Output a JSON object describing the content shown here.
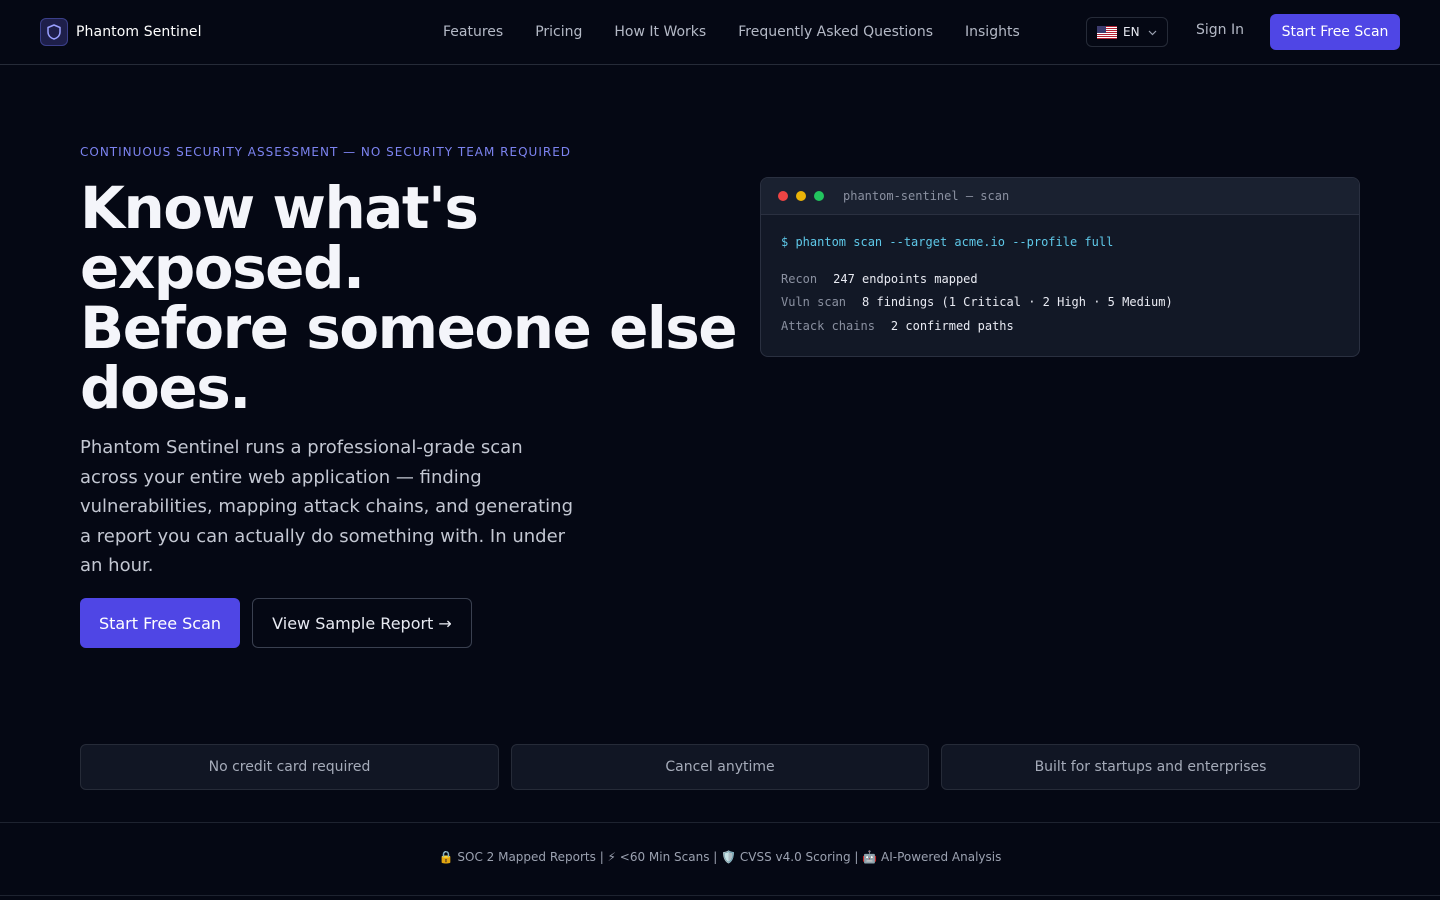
{
  "colors": {
    "accent": "#4f46e5",
    "background": "#050814",
    "eyebrow": "#7c83f0",
    "terminal_cmd": "#5ec8e8",
    "dot_red": "#ef4444",
    "dot_yellow": "#eab308",
    "dot_green": "#22c55e"
  },
  "nav": {
    "brand_icon": "shield-icon",
    "brand": "Phantom Sentinel",
    "links": [
      "Features",
      "Pricing",
      "How It Works",
      "Frequently Asked Questions",
      "Insights"
    ],
    "language_flag_icon": "us-flag-icon",
    "language": "EN",
    "sign_in": "Sign In",
    "cta": "Start Free Scan"
  },
  "hero": {
    "eyebrow": "CONTINUOUS SECURITY ASSESSMENT — NO SECURITY TEAM REQUIRED",
    "headline": [
      "Know what's",
      "exposed.",
      "Before someone else",
      "does."
    ],
    "lede": "Phantom Sentinel runs a professional-grade scan across your entire web application — finding vulnerabilities, mapping attack chains, and generating a report you can actually do something with. In under an hour.",
    "primary_cta": "Start Free Scan",
    "secondary_cta": "View Sample Report →"
  },
  "terminal": {
    "title": "phantom-sentinel — scan",
    "command": "$ phantom scan --target acme.io --profile full",
    "rows": [
      {
        "key": "Recon",
        "value": "247 endpoints mapped"
      },
      {
        "key": "Vuln scan",
        "value": "8 findings (1 Critical · 2 High · 5 Medium)"
      },
      {
        "key": "Attack chains",
        "value": "2 confirmed paths"
      }
    ]
  },
  "features": [
    "No credit card required",
    "Cancel anytime",
    "Built for startups and enterprises"
  ],
  "trust_bar": "🔒 SOC 2 Mapped Reports | ⚡ <60 Min Scans | 🛡️ CVSS v4.0 Scoring | 🤖 AI-Powered Analysis"
}
